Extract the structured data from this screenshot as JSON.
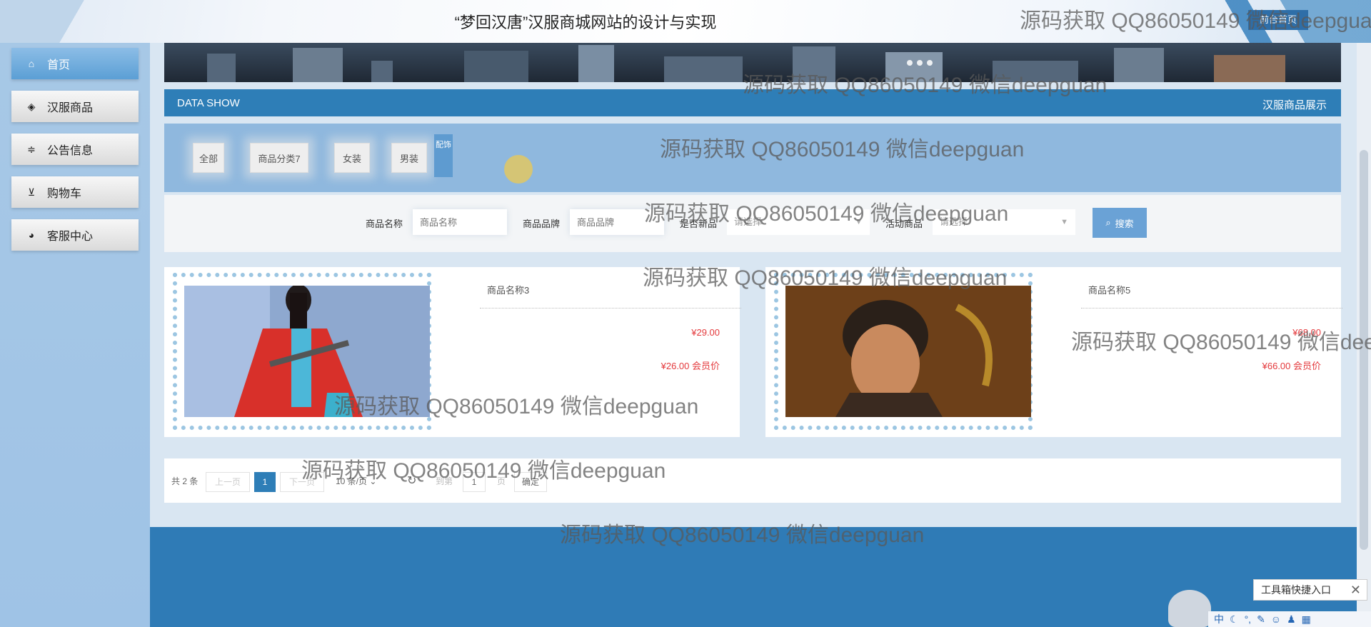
{
  "header": {
    "title": "“梦回汉唐”汉服商城网站的设计与实现",
    "top_button": "前台首页"
  },
  "sidebar": {
    "items": [
      {
        "label": "首页",
        "icon": "home-icon",
        "active": true
      },
      {
        "label": "汉服商品",
        "icon": "layers-icon",
        "active": false
      },
      {
        "label": "公告信息",
        "icon": "sliders-icon",
        "active": false
      },
      {
        "label": "购物车",
        "icon": "cart-icon",
        "active": false
      },
      {
        "label": "客服中心",
        "icon": "support-icon",
        "active": false
      }
    ]
  },
  "section": {
    "left_title": "DATA SHOW",
    "right_title": "汉服商品展示"
  },
  "categories": [
    "全部",
    "商品分类7",
    "女装",
    "男装"
  ],
  "category_extra": "配饰",
  "search": {
    "name_label": "商品名称",
    "name_placeholder": "商品名称",
    "brand_label": "商品品牌",
    "brand_placeholder": "商品品牌",
    "new_label": "是否新品",
    "new_value": "请选择",
    "activity_label": "活动商品",
    "activity_value": "请选择",
    "button": "搜索"
  },
  "products": [
    {
      "name": "商品名称3",
      "price": "¥29.00",
      "vip_price": "¥26.00 会员价"
    },
    {
      "name": "商品名称5",
      "price": "¥68.00",
      "vip_price": "¥66.00 会员价"
    }
  ],
  "pager": {
    "total": "共 2 条",
    "prev": "上一页",
    "current": "1",
    "next": "下一页",
    "page_size": "10 条/页",
    "goto_label": "到第",
    "goto_value": "1",
    "page_unit": "页",
    "confirm": "确定"
  },
  "watermark": "源码获取 QQ86050149 微信deepguan",
  "toolbox": {
    "label": "工具箱快捷入口"
  },
  "ime": {
    "lang": "中"
  },
  "colors": {
    "primary": "#2e7eb7",
    "price": "#e4393c",
    "sidebar": "#a7c8e6"
  }
}
